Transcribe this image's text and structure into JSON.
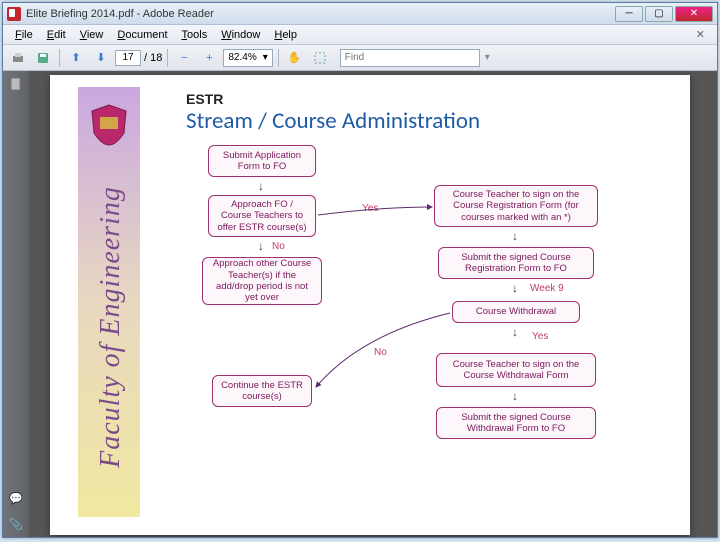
{
  "window": {
    "title": "Elite Briefing 2014.pdf - Adobe Reader"
  },
  "menu": {
    "file": "File",
    "edit": "Edit",
    "view": "View",
    "document": "Document",
    "tools": "Tools",
    "window": "Window",
    "help": "Help"
  },
  "toolbar": {
    "page_current": "17",
    "page_total": "/ 18",
    "zoom": "82.4%",
    "find_placeholder": "Find"
  },
  "slide": {
    "vertical_title": "Faculty of Engineering",
    "estr": "ESTR",
    "title": "Stream / Course Administration",
    "boxes": {
      "b1": "Submit Application Form to FO",
      "b2": "Approach FO / Course Teachers to offer ESTR course(s)",
      "b3": "Approach other Course Teacher(s) if the add/drop period is not yet over",
      "b4": "Continue the ESTR course(s)",
      "b5": "Course Teacher to sign on the Course Registration Form (for courses marked with an *)",
      "b6": "Submit the signed Course Registration Form to FO",
      "b7": "Course Withdrawal",
      "b8": "Course Teacher to sign on the Course Withdrawal Form",
      "b9": "Submit the signed Course Withdrawal Form to FO"
    },
    "labels": {
      "yes1": "Yes",
      "no1": "No",
      "week9": "Week 9",
      "no2": "No",
      "yes2": "Yes"
    }
  }
}
